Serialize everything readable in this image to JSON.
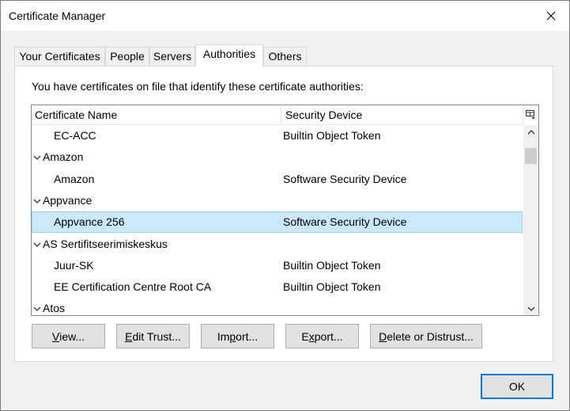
{
  "window": {
    "title": "Certificate Manager"
  },
  "tabs": [
    {
      "label": "Your Certificates"
    },
    {
      "label": "People"
    },
    {
      "label": "Servers"
    },
    {
      "label": "Authorities",
      "active": true
    },
    {
      "label": "Others"
    }
  ],
  "intro_text": "You have certificates on file that identify these certificate authorities:",
  "tree": {
    "columns": [
      "Certificate Name",
      "Security Device"
    ],
    "rows": [
      {
        "type": "child",
        "name": "EC-ACC",
        "device": "Builtin Object Token"
      },
      {
        "type": "group",
        "name": "Amazon",
        "device": ""
      },
      {
        "type": "child",
        "name": "Amazon",
        "device": "Software Security Device"
      },
      {
        "type": "group",
        "name": "Appvance",
        "device": ""
      },
      {
        "type": "child",
        "name": "Appvance 256",
        "device": "Software Security Device",
        "selected": true
      },
      {
        "type": "group",
        "name": "AS Sertifitseerimiskeskus",
        "device": ""
      },
      {
        "type": "child",
        "name": "Juur-SK",
        "device": "Builtin Object Token"
      },
      {
        "type": "child",
        "name": "EE Certification Centre Root CA",
        "device": "Builtin Object Token"
      },
      {
        "type": "group",
        "name": "Atos",
        "device": ""
      }
    ]
  },
  "buttons": {
    "view": {
      "acc": "V",
      "rest": "iew..."
    },
    "edit_trust": {
      "acc": "E",
      "rest": "dit Trust..."
    },
    "import": {
      "pre": "Im",
      "acc": "p",
      "rest": "ort..."
    },
    "export": {
      "acc": "x",
      "pre": "E",
      "rest": "port..."
    },
    "delete": {
      "acc": "D",
      "rest": "elete or Distrust..."
    }
  },
  "ok_label": "OK",
  "icons": {
    "close": "close-icon",
    "column_picker": "column-picker-icon",
    "twisty": "chevron-down-icon"
  }
}
